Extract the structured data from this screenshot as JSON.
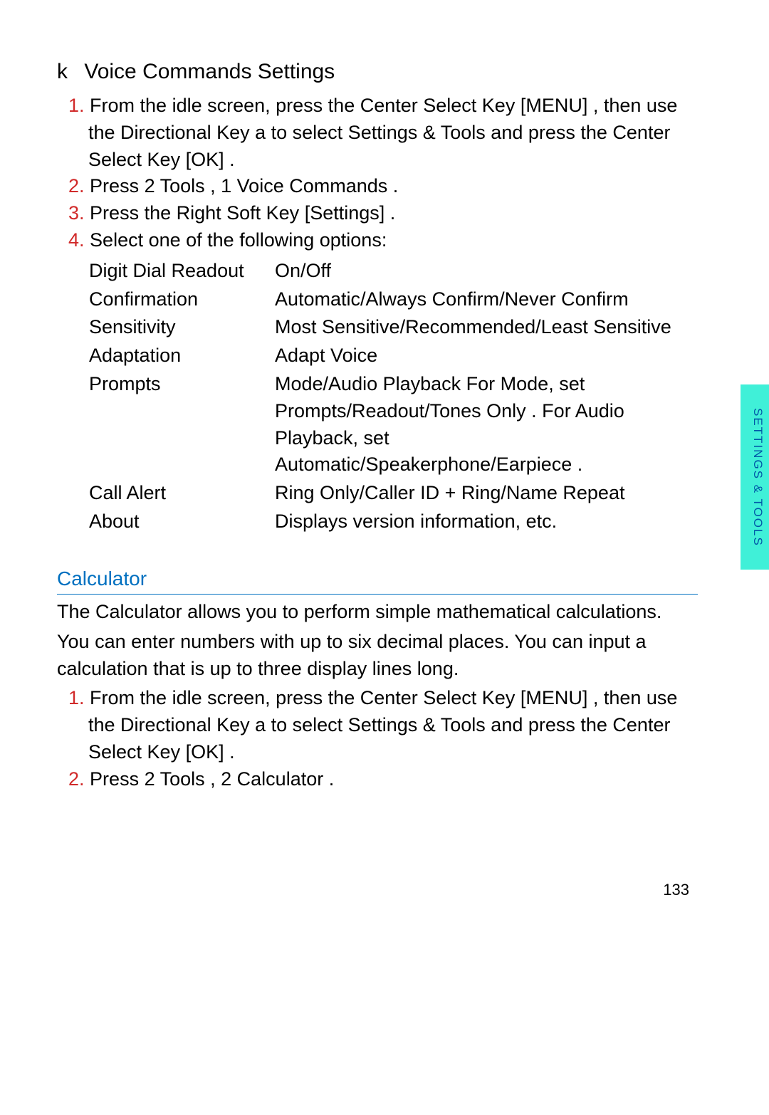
{
  "side_tab": "SETTINGS & TOOLS",
  "page_number": "133",
  "voice": {
    "k": "k",
    "title": "Voice Commands Settings",
    "s1_num": "1.",
    "s1_a": "From the idle screen, press the Center Select Key ",
    "s1_b": "[MENU]",
    "s1_c": ", then use the Directional Key a    to select Settings & Tools and press the Center Select Key ",
    "s1_d": "[OK]",
    "s1_e": " .",
    "s2_num": "2.",
    "s2_a": "Press 2",
    "s2_b": "     Tools , 1      Voice Commands  .",
    "s3_num": "3.",
    "s3_a": "Press the Right Soft Key",
    "s3_b": "[Settings]  .",
    "s4_num": "4.",
    "s4_a": "Select one of the following options:",
    "r1l": "Digit Dial Readout",
    "r1v": "On/Off",
    "r2l": "Confirmation",
    "r2v": "Automatic/Always Confirm/Never Confirm",
    "r3l": "Sensitivity",
    "r3v": "Most Sensitive/Recommended/Least Sensitive",
    "r4l": "Adaptation",
    "r4v": "Adapt Voice",
    "r5l": "Prompts",
    "r5v": "Mode/Audio Playback    For Mode, set Prompts/Readout/Tones Only   . For Audio Playback, set Automatic/Speakerphone/Earpiece     .",
    "r6l": "Call Alert",
    "r6v": "Ring Only/Caller ID + Ring/Name Repeat",
    "r7l": "About",
    "r7v": "Displays version information, etc."
  },
  "calc": {
    "heading": "Calculator",
    "p1": "The Calculator allows you to perform simple mathematical calculations.",
    "p2": "You can enter numbers with up to six decimal places. You can input a calculation that is up to three display lines long.",
    "s1_num": "1.",
    "s1_a": "From the idle screen, press the Center Select Key ",
    "s1_b": "[MENU]",
    "s1_c": ", then use the Directional Key a    to select Settings & Tools and press the Center Select Key ",
    "s1_d": "[OK]",
    "s1_e": " .",
    "s2_num": "2.",
    "s2_a": "Press 2",
    "s2_b": "      Tools , 2       Calculator ."
  }
}
